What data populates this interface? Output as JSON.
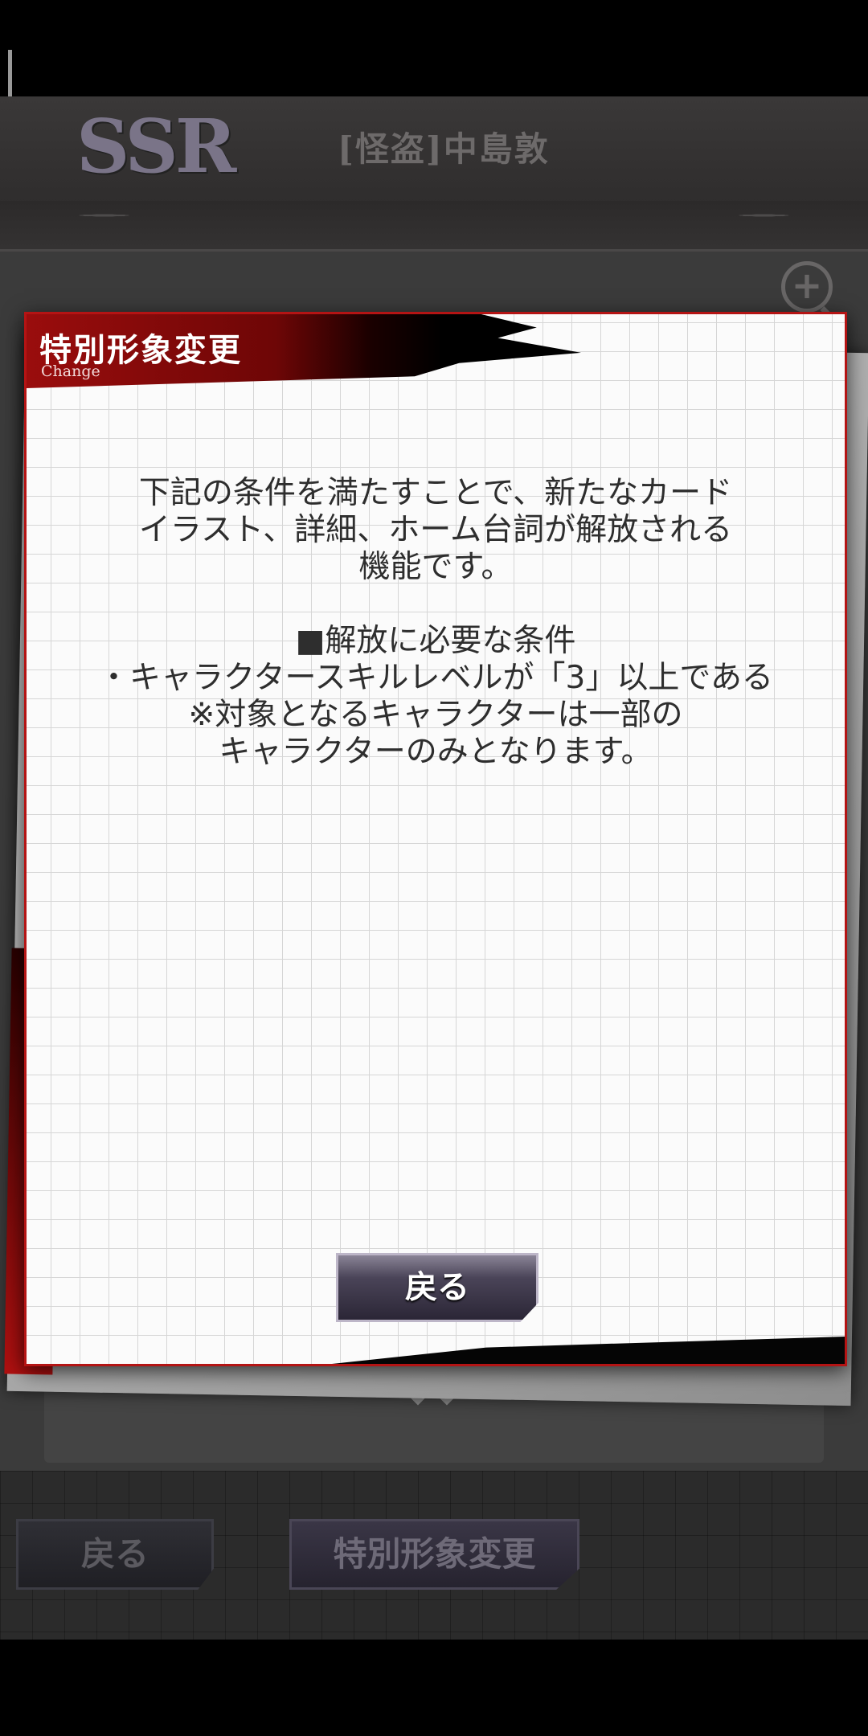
{
  "background": {
    "rarity": "SSR",
    "card_name": "[怪盗]中島敦",
    "zoom_icon": "zoom-in-icon",
    "footer": {
      "back_label": "戻る",
      "change_label": "特別形象変更"
    }
  },
  "modal": {
    "title": "特別形象変更",
    "subtitle": "Change",
    "description_lines": [
      "下記の条件を満たすことで、新たなカード",
      "イラスト、詳細、ホーム台詞が解放される",
      "機能です。"
    ],
    "condition_lines": [
      "■解放に必要な条件",
      "・キャラクタースキルレベルが「3」以上である",
      "※対象となるキャラクターは一部の",
      "キャラクターのみとなります。"
    ],
    "back_label": "戻る"
  },
  "colors": {
    "accent_red": "#b41414",
    "button_purple": "#4a4458"
  }
}
